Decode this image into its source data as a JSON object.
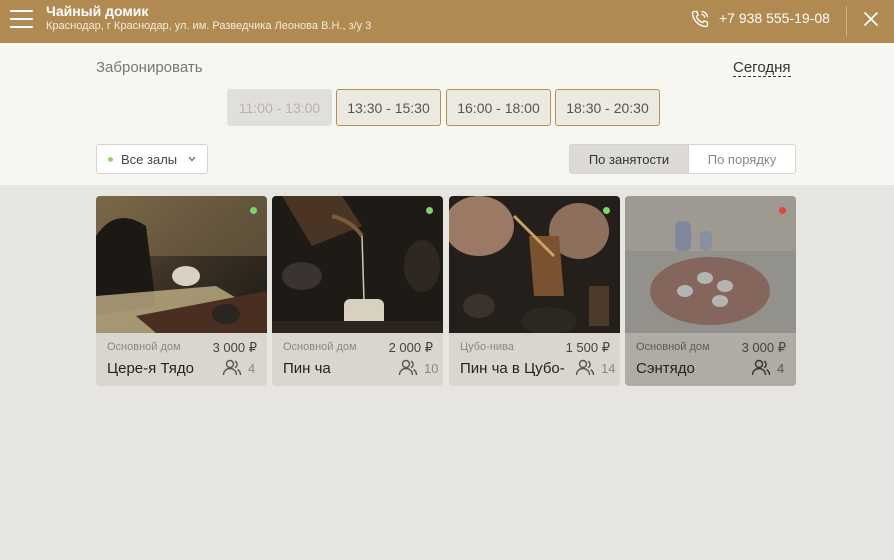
{
  "header": {
    "title": "Чайный домик",
    "address": "Краснодар, г Краснодар, ул. им. Разведчика Леонова В.Н., з/у 3",
    "phone": "+7 938 555-19-08",
    "bg_color": "#b08a50"
  },
  "booking": {
    "label": "Забронировать",
    "date_link": "Сегодня",
    "slots": [
      {
        "label": "11:00 - 13:00",
        "state": "disabled"
      },
      {
        "label": "13:30 - 15:30",
        "state": "available"
      },
      {
        "label": "16:00 - 18:00",
        "state": "available"
      },
      {
        "label": "18:30 - 20:30",
        "state": "available"
      }
    ],
    "accent_color": "#b38f59"
  },
  "filters": {
    "hall_select": "Все залы",
    "sort_options": [
      "По занятости",
      "По порядку"
    ],
    "sort_selected": "По занятости"
  },
  "halls": [
    {
      "location": "Основной дом",
      "price": "3 000 ₽",
      "name": "Цере-я Тядо",
      "capacity": "4",
      "status": "free",
      "status_color": "#7ed36a"
    },
    {
      "location": "Основной дом",
      "price": "2 000 ₽",
      "name": "Пин ча",
      "capacity": "10",
      "status": "free",
      "status_color": "#7ed36a"
    },
    {
      "location": "Цубо-нива",
      "price": "1 500 ₽",
      "name": "Пин ча в Цубо-нива",
      "capacity": "14",
      "status": "free",
      "status_color": "#7ed36a"
    },
    {
      "location": "Основной дом",
      "price": "3 000 ₽",
      "name": "Сэнтядо",
      "capacity": "4",
      "status": "busy",
      "status_color": "#e2473d"
    }
  ],
  "icons": {
    "menu": "burger-menu-icon",
    "phone": "phone-icon",
    "close": "close-icon",
    "chevron": "chevron-down-icon",
    "people": "people-icon"
  }
}
